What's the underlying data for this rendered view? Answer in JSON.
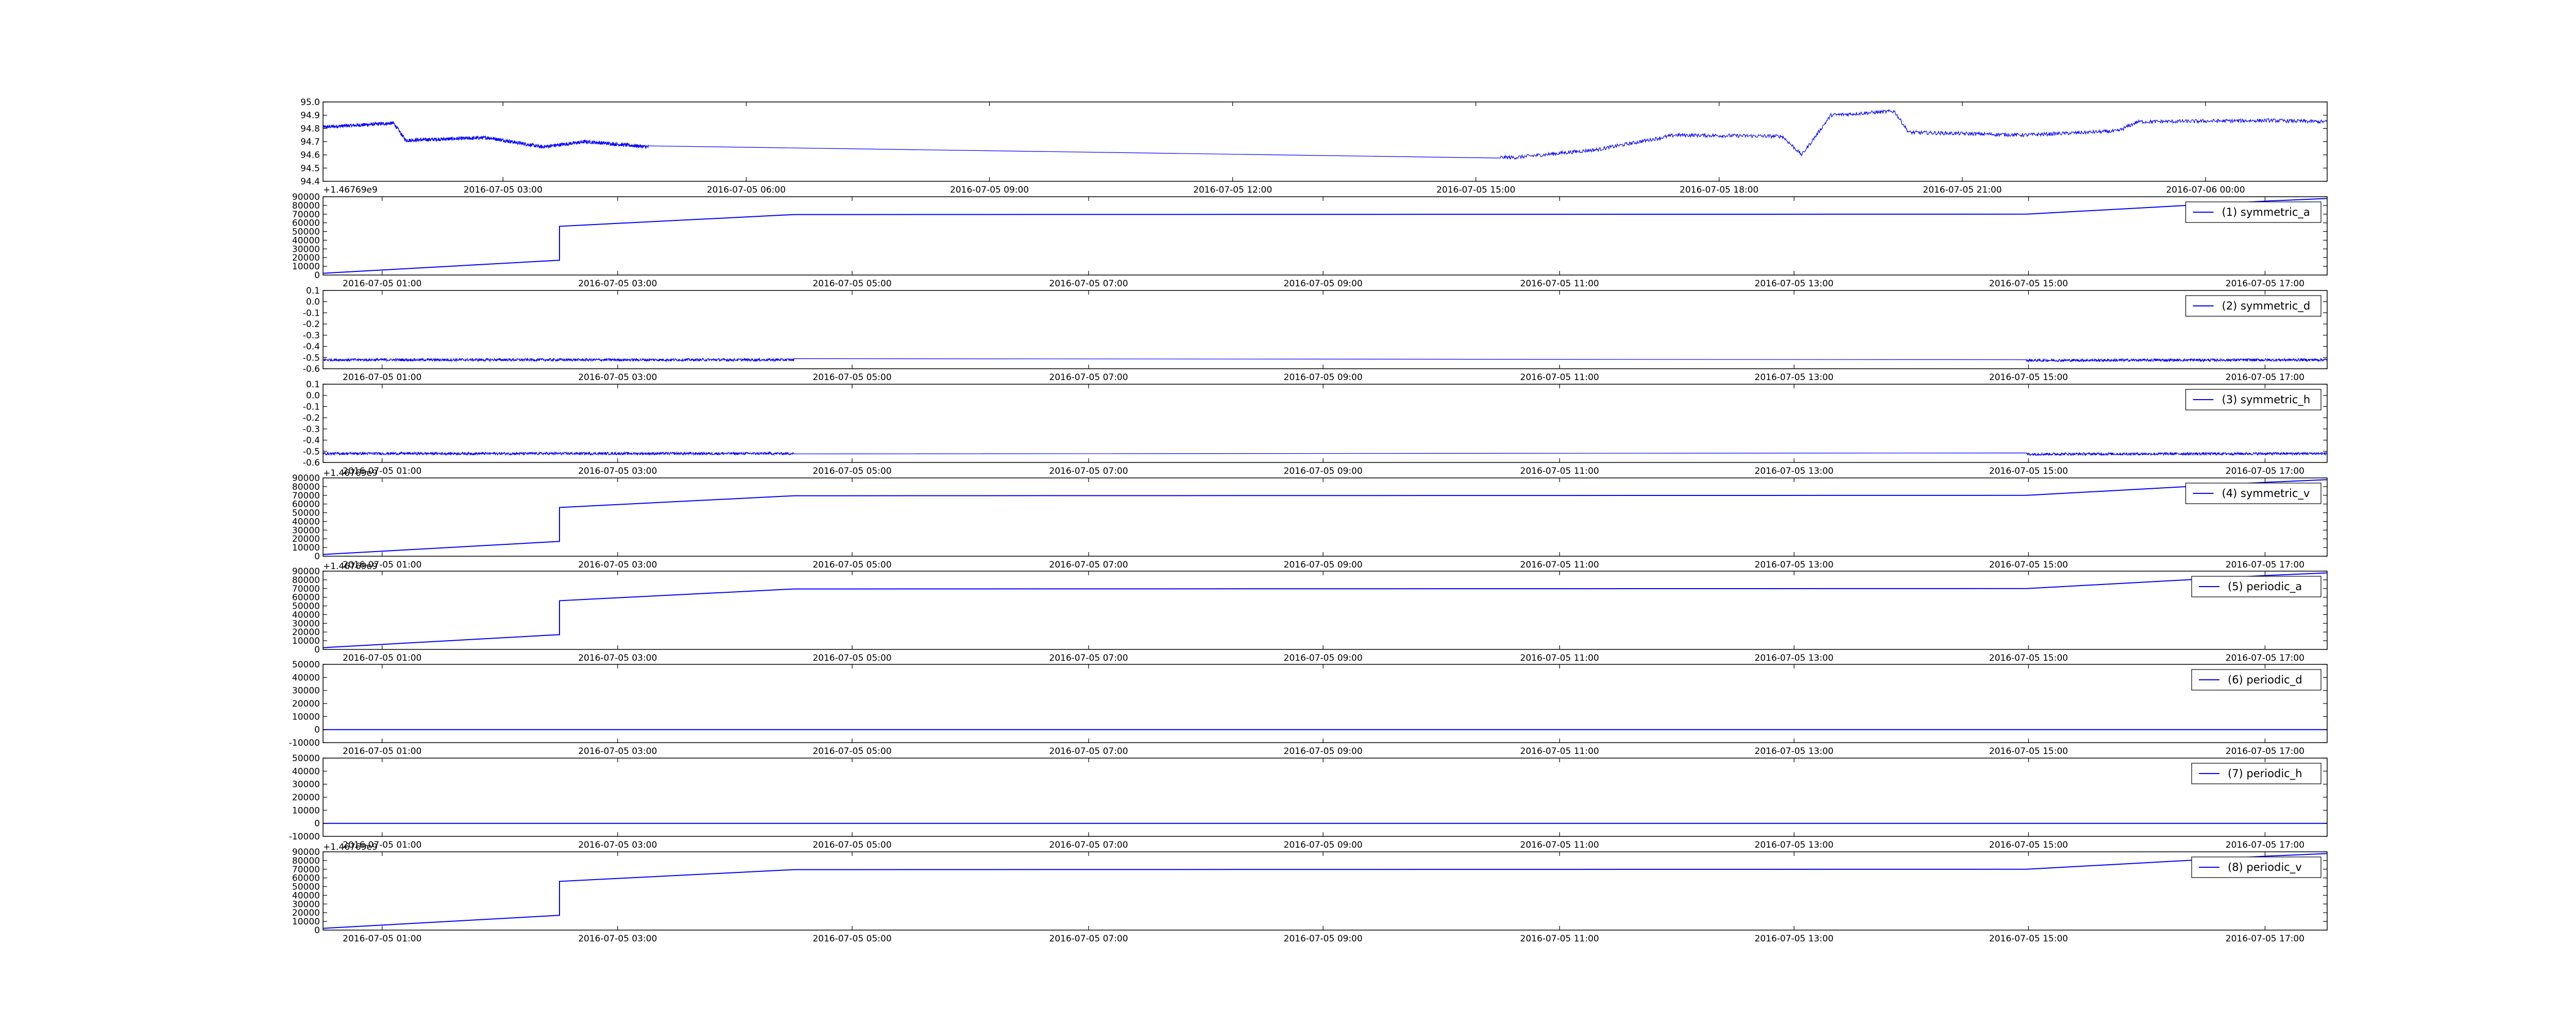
{
  "figure": {
    "background": "#ffffff",
    "line_color": "#0000ff",
    "axes_color": "#000000"
  },
  "chart_data": [
    {
      "type": "line",
      "id": "p0",
      "ylim": [
        94.4,
        95.0
      ],
      "yticks": [
        "94.4",
        "94.5",
        "94.6",
        "94.7",
        "94.8",
        "94.9",
        "95.0"
      ],
      "xticks": [
        "2016-07-05 03:00",
        "2016-07-05 06:00",
        "2016-07-05 09:00",
        "2016-07-05 12:00",
        "2016-07-05 15:00",
        "2016-07-05 18:00",
        "2016-07-05 21:00",
        "2016-07-06 00:00"
      ],
      "offset_text": "+1.46769e9",
      "legend": null,
      "noisy": true,
      "series_points": [
        [
          0,
          94.81
        ],
        [
          1.45,
          94.84
        ],
        [
          1.7,
          94.71
        ],
        [
          3.4,
          94.73
        ],
        [
          4.5,
          94.66
        ],
        [
          5.4,
          94.7
        ],
        [
          6.7,
          94.66
        ],
        [
          19.4,
          94.6
        ],
        [
          24.5,
          94.58
        ],
        [
          26.2,
          94.64
        ],
        [
          27.8,
          94.75
        ],
        [
          30.0,
          94.74
        ],
        [
          30.4,
          94.6
        ],
        [
          31.0,
          94.9
        ],
        [
          32.3,
          94.93
        ],
        [
          32.6,
          94.77
        ],
        [
          35.0,
          94.75
        ],
        [
          36.9,
          94.78
        ],
        [
          37.3,
          94.85
        ],
        [
          40.0,
          94.86
        ],
        [
          41.2,
          94.85
        ]
      ],
      "x_domain": [
        0,
        41.2
      ],
      "xtick_pos": [
        3.7,
        8.7,
        13.7,
        18.7,
        23.7,
        28.7,
        33.7,
        38.7
      ]
    },
    {
      "type": "line",
      "id": "p1",
      "ylim": [
        0,
        90000
      ],
      "yticks": [
        "0",
        "10000",
        "20000",
        "30000",
        "40000",
        "50000",
        "60000",
        "70000",
        "80000",
        "90000"
      ],
      "xticks": [
        "2016-07-05 01:00",
        "2016-07-05 03:00",
        "2016-07-05 05:00",
        "2016-07-05 07:00",
        "2016-07-05 09:00",
        "2016-07-05 11:00",
        "2016-07-05 13:00",
        "2016-07-05 15:00",
        "2016-07-05 17:00"
      ],
      "offset_text": "",
      "legend": "(1) symmetric_a",
      "noisy": false,
      "series_points": [
        [
          0,
          2000
        ],
        [
          0.118,
          17000
        ],
        [
          0.118,
          56000
        ],
        [
          0.235,
          69500
        ],
        [
          0.85,
          70000
        ],
        [
          0.97,
          85000
        ],
        [
          1.0,
          88000
        ]
      ]
    },
    {
      "type": "line",
      "id": "p2",
      "ylim": [
        -0.6,
        0.1
      ],
      "yticks": [
        "-0.6",
        "-0.5",
        "-0.4",
        "-0.3",
        "-0.2",
        "-0.1",
        "0.0",
        "0.1"
      ],
      "xticks": [
        "2016-07-05 01:00",
        "2016-07-05 03:00",
        "2016-07-05 05:00",
        "2016-07-05 07:00",
        "2016-07-05 09:00",
        "2016-07-05 11:00",
        "2016-07-05 13:00",
        "2016-07-05 15:00",
        "2016-07-05 17:00"
      ],
      "offset_text": "",
      "legend": "(2) symmetric_d",
      "noisy": true,
      "series_points": [
        [
          0,
          -0.52
        ],
        [
          0.235,
          -0.52
        ],
        [
          0.85,
          -0.525
        ],
        [
          1.0,
          -0.52
        ]
      ],
      "noise_ranges": [
        [
          0,
          0.235
        ],
        [
          0.85,
          1.0
        ]
      ],
      "noise_amp": 0.012
    },
    {
      "type": "line",
      "id": "p3",
      "ylim": [
        -0.6,
        0.1
      ],
      "yticks": [
        "-0.6",
        "-0.5",
        "-0.4",
        "-0.3",
        "-0.2",
        "-0.1",
        "0.0",
        "0.1"
      ],
      "xticks": [
        "2016-07-05 01:00",
        "2016-07-05 03:00",
        "2016-07-05 05:00",
        "2016-07-05 07:00",
        "2016-07-05 09:00",
        "2016-07-05 11:00",
        "2016-07-05 13:00",
        "2016-07-05 15:00",
        "2016-07-05 17:00"
      ],
      "offset_text": "",
      "legend": "(3) symmetric_h",
      "noisy": true,
      "series_points": [
        [
          0,
          -0.52
        ],
        [
          0.235,
          -0.52
        ],
        [
          0.85,
          -0.525
        ],
        [
          1.0,
          -0.52
        ]
      ],
      "noise_ranges": [
        [
          0,
          0.235
        ],
        [
          0.85,
          1.0
        ]
      ],
      "noise_amp": 0.012
    },
    {
      "type": "line",
      "id": "p4",
      "ylim": [
        0,
        90000
      ],
      "yticks": [
        "0",
        "10000",
        "20000",
        "30000",
        "40000",
        "50000",
        "60000",
        "70000",
        "80000",
        "90000"
      ],
      "xticks": [
        "2016-07-05 01:00",
        "2016-07-05 03:00",
        "2016-07-05 05:00",
        "2016-07-05 07:00",
        "2016-07-05 09:00",
        "2016-07-05 11:00",
        "2016-07-05 13:00",
        "2016-07-05 15:00",
        "2016-07-05 17:00"
      ],
      "offset_text": "+1.46769e9",
      "legend": "(4) symmetric_v",
      "noisy": false,
      "series_points": [
        [
          0,
          2000
        ],
        [
          0.118,
          17000
        ],
        [
          0.118,
          56000
        ],
        [
          0.235,
          69500
        ],
        [
          0.85,
          70000
        ],
        [
          0.97,
          85000
        ],
        [
          1.0,
          88000
        ]
      ]
    },
    {
      "type": "line",
      "id": "p5",
      "ylim": [
        0,
        90000
      ],
      "yticks": [
        "0",
        "10000",
        "20000",
        "30000",
        "40000",
        "50000",
        "60000",
        "70000",
        "80000",
        "90000"
      ],
      "xticks": [
        "2016-07-05 01:00",
        "2016-07-05 03:00",
        "2016-07-05 05:00",
        "2016-07-05 07:00",
        "2016-07-05 09:00",
        "2016-07-05 11:00",
        "2016-07-05 13:00",
        "2016-07-05 15:00",
        "2016-07-05 17:00"
      ],
      "offset_text": "+1.46769e9",
      "legend": "(5) periodic_a",
      "noisy": false,
      "series_points": [
        [
          0,
          2000
        ],
        [
          0.118,
          17000
        ],
        [
          0.118,
          56000
        ],
        [
          0.235,
          69500
        ],
        [
          0.85,
          70000
        ],
        [
          0.97,
          85000
        ],
        [
          1.0,
          88000
        ]
      ]
    },
    {
      "type": "line",
      "id": "p6",
      "ylim": [
        -10000,
        50000
      ],
      "yticks": [
        "-10000",
        "0",
        "10000",
        "20000",
        "30000",
        "40000",
        "50000"
      ],
      "xticks": [
        "2016-07-05 01:00",
        "2016-07-05 03:00",
        "2016-07-05 05:00",
        "2016-07-05 07:00",
        "2016-07-05 09:00",
        "2016-07-05 11:00",
        "2016-07-05 13:00",
        "2016-07-05 15:00",
        "2016-07-05 17:00"
      ],
      "offset_text": "",
      "legend": "(6) periodic_d",
      "noisy": false,
      "series_points": [
        [
          0,
          0
        ],
        [
          1.0,
          0
        ]
      ]
    },
    {
      "type": "line",
      "id": "p7",
      "ylim": [
        -10000,
        50000
      ],
      "yticks": [
        "-10000",
        "0",
        "10000",
        "20000",
        "30000",
        "40000",
        "50000"
      ],
      "xticks": [
        "2016-07-05 01:00",
        "2016-07-05 03:00",
        "2016-07-05 05:00",
        "2016-07-05 07:00",
        "2016-07-05 09:00",
        "2016-07-05 11:00",
        "2016-07-05 13:00",
        "2016-07-05 15:00",
        "2016-07-05 17:00"
      ],
      "offset_text": "",
      "legend": "(7) periodic_h",
      "noisy": false,
      "series_points": [
        [
          0,
          0
        ],
        [
          1.0,
          0
        ]
      ]
    },
    {
      "type": "line",
      "id": "p8",
      "ylim": [
        0,
        90000
      ],
      "yticks": [
        "0",
        "10000",
        "20000",
        "30000",
        "40000",
        "50000",
        "60000",
        "70000",
        "80000",
        "90000"
      ],
      "xticks": [
        "2016-07-05 01:00",
        "2016-07-05 03:00",
        "2016-07-05 05:00",
        "2016-07-05 07:00",
        "2016-07-05 09:00",
        "2016-07-05 11:00",
        "2016-07-05 13:00",
        "2016-07-05 15:00",
        "2016-07-05 17:00"
      ],
      "offset_text": "+1.46769e9",
      "legend": "(8) periodic_v",
      "noisy": false,
      "series_points": [
        [
          0,
          2000
        ],
        [
          0.118,
          17000
        ],
        [
          0.118,
          56000
        ],
        [
          0.235,
          69500
        ],
        [
          0.85,
          70000
        ],
        [
          0.97,
          85000
        ],
        [
          1.0,
          88000
        ]
      ]
    }
  ]
}
